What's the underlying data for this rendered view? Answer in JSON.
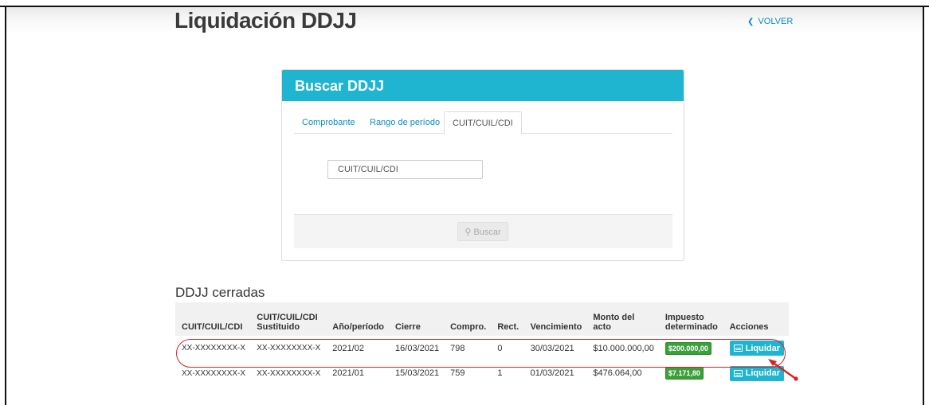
{
  "page": {
    "title": "Liquidación DDJJ",
    "back_label": "VOLVER"
  },
  "search": {
    "title": "Buscar DDJJ",
    "tabs": [
      "Comprobante",
      "Rango de período",
      "CUIT/CUIL/CDI"
    ],
    "active_tab": "CUIT/CUIL/CDI",
    "input_placeholder": "CUIT/CUIL/CDI",
    "input_value": "",
    "button_label": "Buscar"
  },
  "closed": {
    "title": "DDJJ cerradas",
    "columns": [
      "CUIT/CUIL/CDI",
      "CUIT/CUIL/CDI Sustituido",
      "Año/período",
      "Cierre",
      "Compro.",
      "Rect.",
      "Vencimiento",
      "Monto del acto",
      "Impuesto determinado",
      "Acciones"
    ],
    "rows": [
      {
        "cuit": "XX-XXXXXXXX-X",
        "cuit_sust": "XX-XXXXXXXX-X",
        "periodo": "2021/02",
        "cierre": "16/03/2021",
        "compro": "798",
        "rect": "0",
        "vencimiento": "30/03/2021",
        "monto": "$10.000.000,00",
        "impuesto": "$200.000,00",
        "accion": "Liquidar"
      },
      {
        "cuit": "XX-XXXXXXXX-X",
        "cuit_sust": "XX-XXXXXXXX-X",
        "periodo": "2021/01",
        "cierre": "15/03/2021",
        "compro": "759",
        "rect": "1",
        "vencimiento": "01/03/2021",
        "monto": "$476.064,00",
        "impuesto": "$7.171,80",
        "accion": "Liquidar"
      }
    ]
  },
  "colors": {
    "accent": "#1fb4cf",
    "badge": "#3aa03a",
    "annotation": "#e02020",
    "link": "#0a8ec2"
  }
}
